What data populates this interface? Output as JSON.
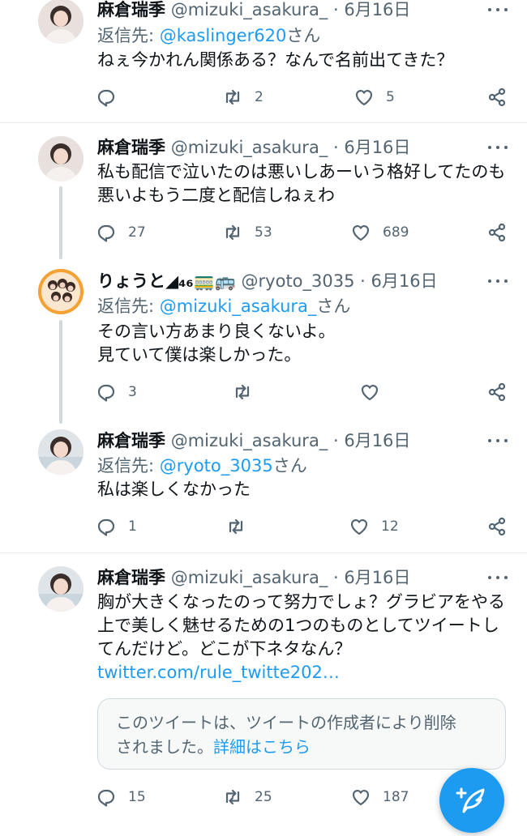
{
  "tweets": [
    {
      "name": "麻倉瑞季",
      "handle": "@mizuki_asakura_ · 6月16日",
      "reply_label": "返信先: ",
      "reply_mention": "@kaslinger620",
      "reply_suffix": "さん",
      "text": "ねぇ今かれん関係ある？なんで名前出てきた？",
      "replies": "",
      "retweets": "2",
      "likes": "5"
    },
    {
      "name": "麻倉瑞季",
      "handle": "@mizuki_asakura_ · 6月16日",
      "text": "私も配信で泣いたのは悪いしあーいう格好してたのも\n悪いよもう二度と配信しねぇわ",
      "replies": "27",
      "retweets": "53",
      "likes": "689"
    },
    {
      "name": "りょうと◢₄₆🚃🚌",
      "handle": "@ryoto_3035 · 6月16日",
      "reply_label": "返信先: ",
      "reply_mention": "@mizuki_asakura_",
      "reply_suffix": "さん",
      "text": "その言い方あまり良くないよ。\n見ていて僕は楽しかった。",
      "replies": "3",
      "retweets": "",
      "likes": ""
    },
    {
      "name": "麻倉瑞季",
      "handle": "@mizuki_asakura_ · 6月16日",
      "reply_label": "返信先: ",
      "reply_mention": "@ryoto_3035",
      "reply_suffix": "さん",
      "text": "私は楽しくなかった",
      "replies": "1",
      "retweets": "",
      "likes": "12"
    },
    {
      "name": "麻倉瑞季",
      "handle": "@mizuki_asakura_ · 6月16日",
      "text": "胸が大きくなったのって努力でしょ？グラビアをやる\n上で美しく魅せるための1つのものとしてツイートし\nてんだけど。どこが下ネタなん？",
      "link": "twitter.com/rule_twitte202…",
      "quote_text": "このツイートは、ツイートの作成者により削除\nされました。",
      "quote_more": "詳細はこちら",
      "replies": "15",
      "retweets": "25",
      "likes": "187"
    }
  ],
  "colors": {
    "accent": "#1d9bf0",
    "secondary_text": "#536471",
    "divider": "#e6ecf0"
  },
  "icons": [
    "reply-icon",
    "retweet-icon",
    "like-icon",
    "share-icon",
    "more-icon",
    "compose-icon"
  ]
}
